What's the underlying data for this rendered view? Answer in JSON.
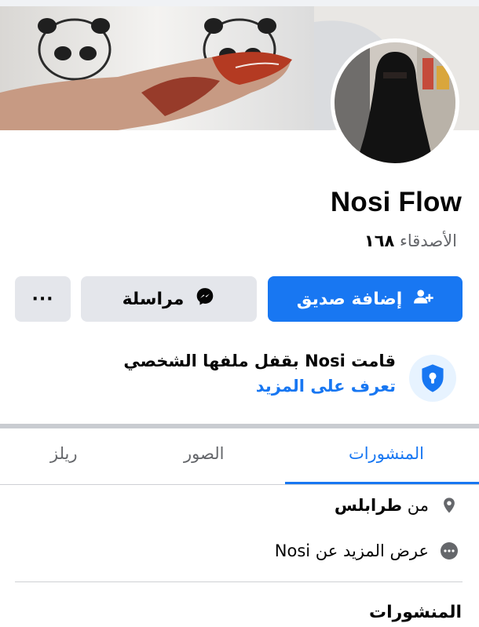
{
  "profile": {
    "name": "Nosi Flow",
    "friends_label": "الأصدقاء",
    "friends_count": "١٦٨"
  },
  "actions": {
    "add_friend_label": "إضافة صديق",
    "message_label": "مراسلة",
    "more_label": "···",
    "add_friend_icon": "add-user-icon",
    "message_icon": "messenger-icon"
  },
  "lock_notice": {
    "title": "قامت Nosi بقفل ملفها الشخصي",
    "link": "تعرف على المزيد",
    "icon": "shield-lock-icon"
  },
  "tabs": [
    {
      "label": "المنشورات",
      "active": true
    },
    {
      "label": "الصور",
      "active": false
    },
    {
      "label": "ريلز",
      "active": false
    }
  ],
  "intro": {
    "location_prefix": "من",
    "location_city": "طرابلس",
    "see_more_label": "عرض المزيد عن Nosi",
    "location_icon": "location-pin-icon",
    "more_icon": "more-dots-icon"
  },
  "posts_section": {
    "title": "المنشورات"
  },
  "colors": {
    "accent": "#1877f2",
    "button_secondary": "#e4e6eb",
    "text_secondary": "#65676b"
  }
}
